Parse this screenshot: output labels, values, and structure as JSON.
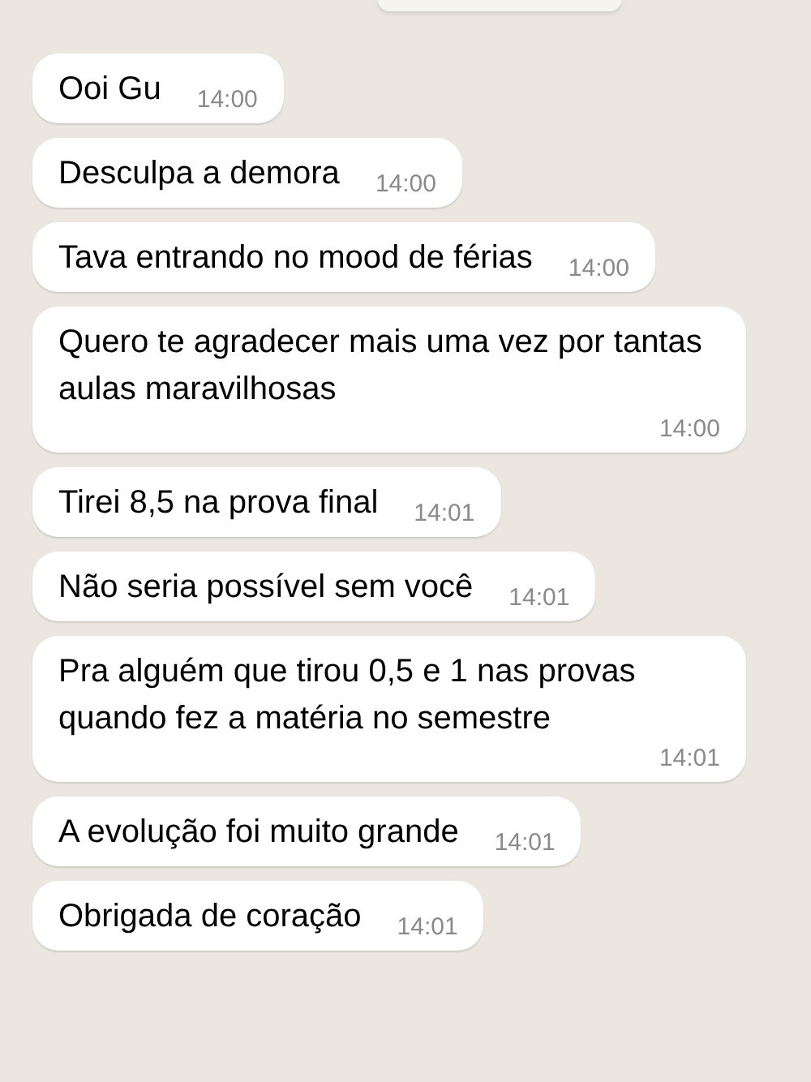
{
  "messages": [
    {
      "text": "Ooi Gu",
      "time": "14:00"
    },
    {
      "text": "Desculpa a demora",
      "time": "14:00"
    },
    {
      "text": "Tava entrando no mood de férias",
      "time": "14:00"
    },
    {
      "text": "Quero te agradecer mais uma vez por tantas aulas maravilhosas",
      "time": "14:00"
    },
    {
      "text": "Tirei 8,5 na prova final",
      "time": "14:01"
    },
    {
      "text": "Não seria possível sem você",
      "time": "14:01"
    },
    {
      "text": "Pra alguém que tirou 0,5 e 1 nas provas quando fez a matéria no semestre",
      "time": "14:01"
    },
    {
      "text": "A evolução foi muito grande",
      "time": "14:01"
    },
    {
      "text": "Obrigada de coração",
      "time": "14:01"
    }
  ]
}
